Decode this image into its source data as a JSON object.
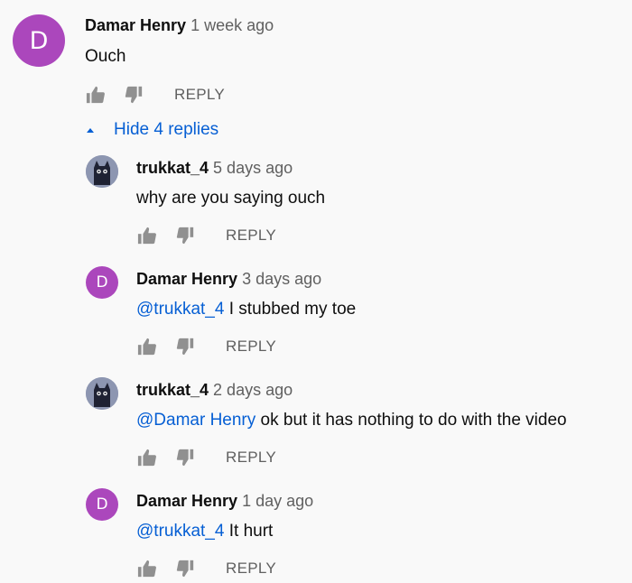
{
  "thread": {
    "top": {
      "avatar_letter": "D",
      "author": "Damar Henry",
      "time": "1 week ago",
      "text": "Ouch",
      "reply_label": "REPLY"
    },
    "replies_toggle": {
      "label": "Hide 4 replies"
    },
    "replies": [
      {
        "avatar": "cat-icon",
        "author": "trukkat_4",
        "time": "5 days ago",
        "mention": "",
        "text": "why are you saying ouch",
        "reply_label": "REPLY"
      },
      {
        "avatar_letter": "D",
        "author": "Damar Henry",
        "time": "3 days ago",
        "mention": "@trukkat_4",
        "text": " I stubbed my toe",
        "reply_label": "REPLY"
      },
      {
        "avatar": "cat-icon",
        "author": "trukkat_4",
        "time": "2 days ago",
        "mention": "@Damar Henry",
        "text": " ok but it has nothing to do with the video",
        "reply_label": "REPLY"
      },
      {
        "avatar_letter": "D",
        "author": "Damar Henry",
        "time": "1 day ago",
        "mention": "@trukkat_4",
        "text": " It hurt",
        "reply_label": "REPLY"
      }
    ]
  },
  "colors": {
    "background": "#f9f9f9",
    "avatar_purple": "#ab47bc",
    "link_blue": "#065fd4",
    "muted_gray": "#606060"
  }
}
